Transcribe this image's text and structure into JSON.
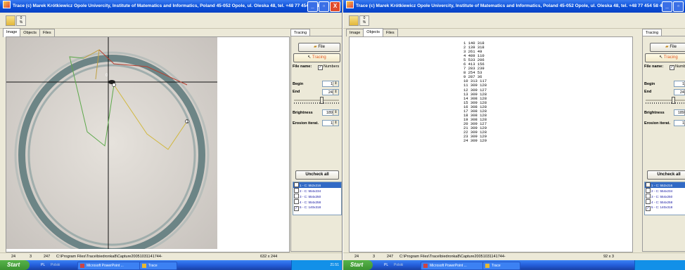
{
  "window_title": "Trace (c)  Marek Krótkiewicz  Opole Univercity, Institute of Matematics and Informatics, Poland 45-052 Opole, ul. Oleska 48, tel. +48 77 454 58 41",
  "title_buttons": {
    "minimize": "_",
    "maximize": "▫",
    "close": "X"
  },
  "tabs": [
    "Image",
    "Objects",
    "Files"
  ],
  "sidebar": {
    "tab": "Tracing",
    "file_button": "File",
    "tracing_button": "Tracing",
    "file_name_label": "File name:",
    "numbers_label": "Numbers",
    "begin_label": "Begin",
    "begin_value": "1",
    "end_label": "End",
    "end_value": "24",
    "slider_fraction": 0.62,
    "brightness_label": "Brightness",
    "brightness_value": "189",
    "erosion_label": "Erosion iterat.",
    "erosion_value": "1",
    "uncheck_button": "Uncheck all",
    "objects": [
      {
        "label": "1 - C: 552x216",
        "checked": false,
        "selected": true
      },
      {
        "label": "2 - C: 554x234",
        "checked": false,
        "selected": false
      },
      {
        "label": "3 - C: 554x250",
        "checked": false,
        "selected": false
      },
      {
        "label": "4 - C: 554x258",
        "checked": false,
        "selected": false
      },
      {
        "label": "5 - C: 140x318",
        "checked": true,
        "selected": false
      }
    ]
  },
  "image_markers": {
    "center": "0",
    "right": "1"
  },
  "status_left": {
    "a": "24",
    "b": "3",
    "c": "247",
    "path": "C:\\Program Files\\Trace\\biedronka8\\Capture20051031141744-",
    "size": "632 x 244"
  },
  "status_right": {
    "a": "24",
    "b": "3",
    "c": "247",
    "path": "C:\\Program Files\\Trace\\biedronka8\\Capture20051031141744-",
    "size": "92 x 3"
  },
  "coords_text": "1 140 318\n2 139 318\n3 261 49\n4 489 110\n5 533 206\n6 413 156\n7 283 239\n8 254 53\n9 287 36\n10 313 117\n11 309 128\n12 309 127\n13 309 128\n14 308 128\n15 309 128\n16 308 128\n17 308 128\n18 308 128\n19 308 128\n20 309 127\n21 309 129\n22 309 128\n23 309 129\n24 309 129",
  "taskbar": {
    "start": "Start",
    "lang": "PL",
    "quick": "Polski",
    "task1": "Microsoft PowerPoint ...",
    "task2": "Trace",
    "clock_left": "21:51"
  },
  "colors": {
    "accent": "#e0561f",
    "titlebar": "#0a4fd8",
    "selection": "#316ac5"
  }
}
